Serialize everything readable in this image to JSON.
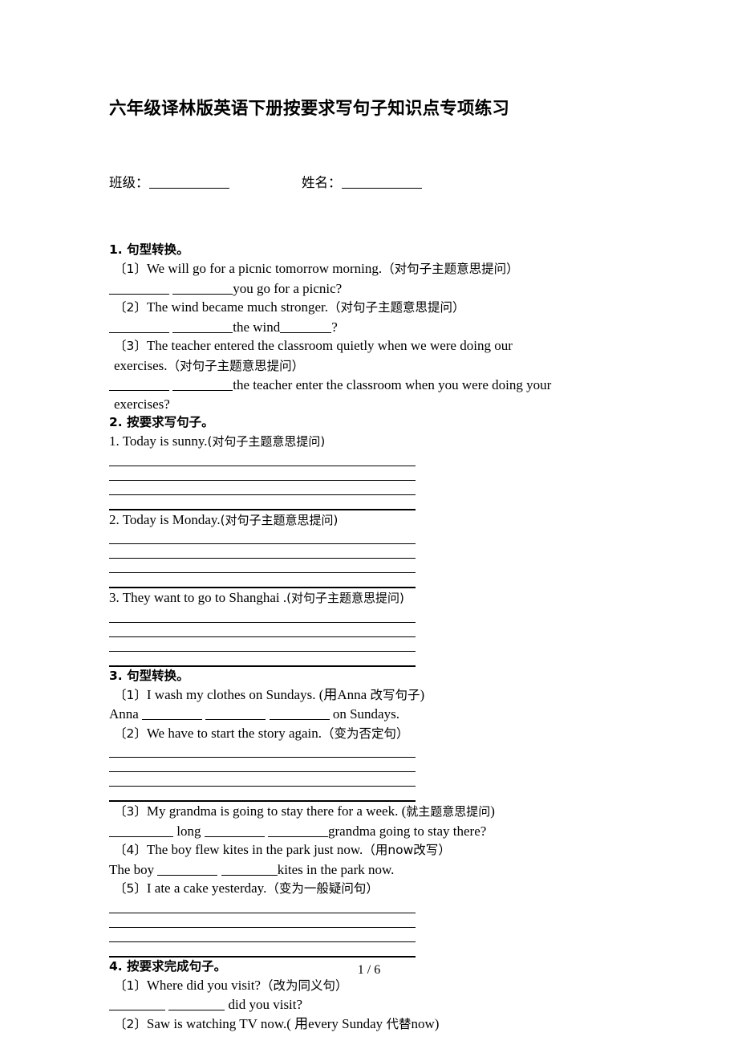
{
  "document": {
    "title": "六年级译林版英语下册按要求写句子知识点专项练习",
    "footer_page": "1 / 6"
  },
  "info": {
    "class_label": "班级：",
    "name_label": "姓名："
  },
  "sections": [
    {
      "heading": "1. 句型转换。",
      "items": [
        {
          "marker": "〔1〕",
          "text": "We will go for a picnic tomorrow morning.",
          "note": "（对句子主题意思提问）"
        },
        {
          "answer_inline_pre": "",
          "answer_inline_mid": "",
          "answer_inline_post": "you go for a picnic?"
        },
        {
          "marker": "〔2〕",
          "text": "The wind became much stronger.",
          "note": "（对句子主题意思提问）"
        },
        {
          "answer_inline_pre": "",
          "answer_inline_mid": "the wind",
          "answer_inline_post": "?"
        },
        {
          "marker": "〔3〕",
          "text": "The teacher entered the classroom quietly when we were doing our",
          "note": ""
        },
        {
          "continued": "exercises.",
          "note": "（对句子主题意思提问）"
        },
        {
          "answer_inline_post": "the teacher enter the classroom when you were doing your"
        },
        {
          "continued": "exercises?"
        }
      ]
    },
    {
      "heading": "2. 按要求写句子。",
      "items": [
        {
          "marker": "1.",
          "text": "Today is sunny.",
          "note": "(对句子主题意思提问)"
        },
        {
          "marker": "2.",
          "text": "Today is Monday.",
          "note": "(对句子主题意思提问)"
        },
        {
          "marker": "3.",
          "text": "They want to go to Shanghai .",
          "note": "(对句子主题意思提问)"
        }
      ]
    },
    {
      "heading": "3. 句型转换。",
      "items": [
        {
          "marker": "〔1〕",
          "text": "I wash my clothes on Sundays. (用Anna 改写句子)"
        },
        {
          "answer_prefix": "Anna",
          "answer_suffix": "on Sundays."
        },
        {
          "marker": "〔2〕",
          "text": "We have to start the story again.",
          "note": "（变为否定句）"
        },
        {
          "marker": "〔3〕",
          "text": "My grandma is going to stay there for a week. (就主题意思提问)"
        },
        {
          "answer_mid": "long",
          "answer_suffix": "grandma going to stay there?"
        },
        {
          "marker": "〔4〕",
          "text": "The boy flew kites in the park just now.",
          "note": "（用now改写）"
        },
        {
          "answer_prefix": "The boy",
          "answer_suffix": "kites in the park now."
        },
        {
          "marker": "〔5〕",
          "text": "I ate a cake yesterday.",
          "note": "（变为一般疑问句）"
        }
      ]
    },
    {
      "heading": "4. 按要求完成句子。",
      "items": [
        {
          "marker": "〔1〕",
          "text": "Where did you visit?",
          "note": "（改为同义句）"
        },
        {
          "answer_suffix": "did you visit?"
        },
        {
          "marker": "〔2〕",
          "text": "Saw is watching TV now.( 用every Sunday 代替now)"
        }
      ]
    }
  ],
  "labels": {
    "s1_head": "1. 句型转换。",
    "s1_i1_mark": "〔1〕",
    "s1_i1_text": "We will go for a picnic tomorrow morning.",
    "s1_i1_note": "（对句子主题意思提问）",
    "s1_i1_ans": "you go for a picnic?",
    "s1_i2_mark": "〔2〕",
    "s1_i2_text": "The wind became much stronger.",
    "s1_i2_note": "（对句子主题意思提问）",
    "s1_i2_ans_mid": "the wind",
    "s1_i2_ans_end": "?",
    "s1_i3_mark": "〔3〕",
    "s1_i3_text": "The teacher entered the classroom quietly when we were doing our",
    "s1_i3_text2": "exercises.",
    "s1_i3_note": "（对句子主题意思提问）",
    "s1_i3_ans": "the teacher enter the classroom when you were doing your",
    "s1_i3_ans2": "exercises?",
    "s2_head": "2. 按要求写句子。",
    "s2_i1": "1. Today is sunny.",
    "s2_i1_note": "(对句子主题意思提问)",
    "s2_i2": "2. Today is Monday.",
    "s2_i2_note": "(对句子主题意思提问)",
    "s2_i3": "3. They want to go to Shanghai .",
    "s2_i3_note": "(对句子主题意思提问)",
    "s3_head": "3. 句型转换。",
    "s3_i1_mark": "〔1〕",
    "s3_i1_text": "I wash my clothes on Sundays. (用Anna ",
    "s3_i1_note": "改写句子",
    "s3_i1_close": ")",
    "s3_i1_pre": "Anna",
    "s3_i1_post": "on Sundays.",
    "s3_i2_mark": "〔2〕",
    "s3_i2_text": "We have to start the story again.",
    "s3_i2_note": "（变为否定句）",
    "s3_i3_mark": "〔3〕",
    "s3_i3_text": "My grandma is going to stay there for a week. (",
    "s3_i3_note": "就主题意思提问",
    "s3_i3_close": ")",
    "s3_i3_mid": "long",
    "s3_i3_post": "grandma going to stay there?",
    "s3_i4_mark": "〔4〕",
    "s3_i4_text": "The boy flew kites in the park just now.",
    "s3_i4_note_open": "（用now",
    "s3_i4_note": "改写",
    "s3_i4_note_close": "）",
    "s3_i4_pre": "The boy",
    "s3_i4_post": "kites in the park now.",
    "s3_i5_mark": "〔5〕",
    "s3_i5_text": "I ate a cake yesterday.",
    "s3_i5_note": "（变为一般疑问句）",
    "s4_head": "4. 按要求完成句子。",
    "s4_i1_mark": "〔1〕",
    "s4_i1_text": "Where did you visit?",
    "s4_i1_note": "（改为同义句）",
    "s4_i1_post": "did you visit?",
    "s4_i2_mark": "〔2〕",
    "s4_i2_text": "Saw is watching TV now.( 用every Sunday ",
    "s4_i2_note": "代替",
    "s4_i2_text2": "now)"
  }
}
